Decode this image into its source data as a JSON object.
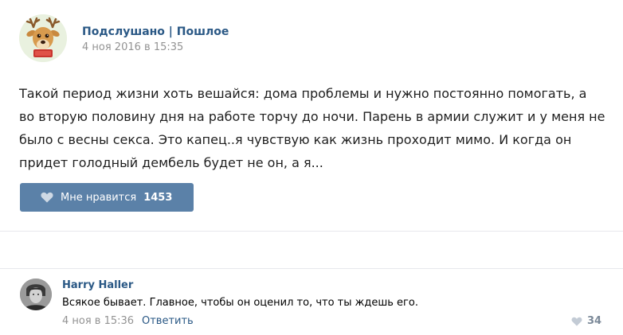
{
  "post": {
    "author": "Подслушано | Пошлое",
    "date": "4 ноя 2016 в 15:35",
    "text_lines": [
      "Такой период жизни хоть вешайся: дома проблемы и нужно постоянно помогать, а",
      "во вторую половину дня на работе торчу до ночи. Парень в армии служит и у меня не",
      "было с весны секса. Это капец..я чувствую как жизнь проходит мимо. И когда он",
      "придет голодный дембель будет не он, а я..."
    ],
    "like_label": "Мне нравится",
    "like_count": "1453",
    "avatar_icon": "reindeer-avatar-icon"
  },
  "comment": {
    "author": "Harry Haller",
    "text": "Всякое бывает. Главное, чтобы он оценил то, что ты ждешь его.",
    "date": "4 ноя в 15:36",
    "reply_label": "Ответить",
    "like_count": "34",
    "avatar_icon": "portrait-avatar-icon"
  },
  "colors": {
    "link": "#2a5885",
    "like_button_bg": "#5b81a8",
    "muted": "#939393",
    "divider": "#e7e8ec"
  }
}
